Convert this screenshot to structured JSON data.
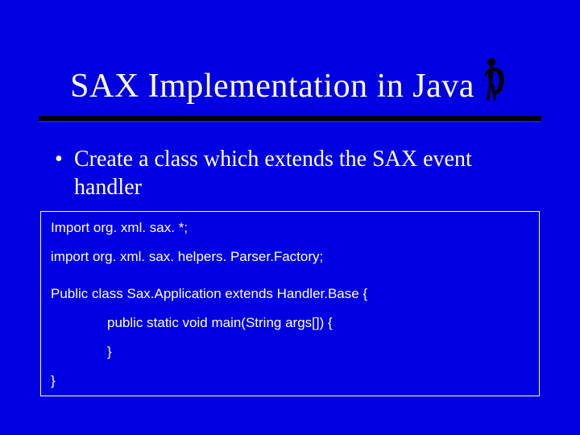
{
  "title": "SAX Implementation in Java",
  "icon_name": "saxophone-player-icon",
  "bullet": "Create a class which extends the SAX event handler",
  "code": {
    "l1": "Import org. xml. sax. *;",
    "l2": "import org. xml. sax. helpers. Parser.Factory;",
    "l3": "Public class Sax.Application extends Handler.Base {",
    "l4": "public static void main(String args[]) {",
    "l5": "}",
    "l6": "}"
  },
  "colors": {
    "background": "#0000e0",
    "rule": "#000000",
    "text": "#ffffff",
    "border": "#ffffff"
  }
}
